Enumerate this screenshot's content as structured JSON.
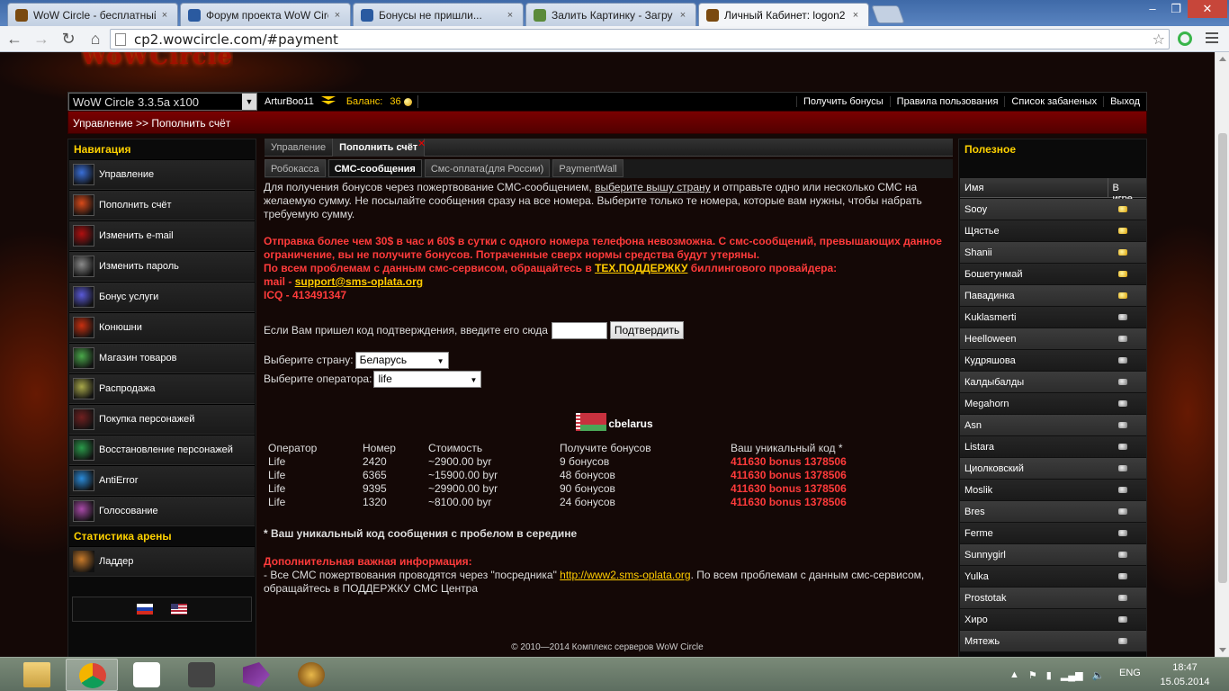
{
  "browser": {
    "tabs": [
      {
        "label": "WoW Circle - бесплатный",
        "icon": "wow-favicon"
      },
      {
        "label": "Форум проекта WoW Circ",
        "icon": "forum-favicon"
      },
      {
        "label": "Бонусы не пришли...",
        "icon": "forum-favicon"
      },
      {
        "label": "Залить Картинку - Загру",
        "icon": "image-host-favicon"
      },
      {
        "label": "Личный Кабинет: logon2",
        "icon": "wow-favicon",
        "active": true
      }
    ],
    "url": "cp2.wowcircle.com/#payment"
  },
  "site": {
    "logo_text": "WoWCircle",
    "realm": "WoW Circle 3.3.5a x100",
    "username": "ArturBoo11",
    "balance_label": "Баланс:",
    "balance_value": "36",
    "top_links": [
      "Получить бонусы",
      "Правила пользования",
      "Список забаненых",
      "Выход"
    ],
    "breadcrumb": "Управление >> Пополнить счёт"
  },
  "nav": {
    "heading": "Навигация",
    "items": [
      {
        "label": "Управление",
        "color": "#3a6fd8"
      },
      {
        "label": "Пополнить счёт",
        "color": "#d84a1a"
      },
      {
        "label": "Изменить e-mail",
        "color": "#b01010"
      },
      {
        "label": "Изменить пароль",
        "color": "#8a8a8a"
      },
      {
        "label": "Бонус услуги",
        "color": "#5a5ad8"
      },
      {
        "label": "Конюшни",
        "color": "#c83010"
      },
      {
        "label": "Магазин товаров",
        "color": "#4aa84a"
      },
      {
        "label": "Распродажа",
        "color": "#a8a84a"
      },
      {
        "label": "Покупка персонажей",
        "color": "#702020"
      },
      {
        "label": "Восстановление персонажей",
        "color": "#2a9a4a"
      },
      {
        "label": "AntiError",
        "color": "#2a8ad8"
      },
      {
        "label": "Голосование",
        "color": "#a84aa8"
      }
    ],
    "arena_heading": "Статистика арены",
    "arena_items": [
      {
        "label": "Ладдер",
        "color": "#c87a2a"
      }
    ]
  },
  "main": {
    "tabs": [
      {
        "label": "Управление"
      },
      {
        "label": "Пополнить счёт",
        "active": true,
        "closable": true
      }
    ],
    "subtabs": [
      {
        "label": "Робокасса"
      },
      {
        "label": "СМС-сообщения",
        "active": true
      },
      {
        "label": "Смс-оплата(для России)"
      },
      {
        "label": "PaymentWall"
      }
    ],
    "intro_1": "Для получения бонусов через пожертвование СМС-сообщением, ",
    "intro_link": "выберите вышу страну",
    "intro_2": " и отправьте одно или несколько СМС на желаемую сумму. Не посылайте сообщения сразу на все номера. Выберите только те номера, которые вам нужны, чтобы набрать требуемую сумму.",
    "warn_1": "Отправка более чем 30$ в час и 60$ в сутки с одного номера телефона невозможна. С смс-сообщений, превышающих данное ограничение, вы не получите бонусов. Потраченные сверх нормы средства будут утеряны.",
    "warn_2a": "По всем проблемам с данным смс-сервисом, обращайтесь в ",
    "warn_2link": "ТЕХ.ПОДДЕРЖКУ",
    "warn_2b": " биллингового провайдера:",
    "mail_label": "mail - ",
    "mail_link": "support@sms-oplata.org",
    "icq": "ICQ - 413491347",
    "confirm_label": "Если Вам пришел код подтверждения, введите его сюда",
    "confirm_button": "Подтвердить",
    "country_label": "Выберите страну:",
    "country_value": "Беларусь",
    "operator_label": "Выберите оператора:",
    "operator_value": "life",
    "country_title": "cbelarus",
    "table": {
      "headers": [
        "Оператор",
        "Номер",
        "Стоимость",
        "Получите бонусов",
        "Ваш уникальный код *"
      ],
      "rows": [
        [
          "Life",
          "2420",
          "~2900.00 byr",
          "9 бонусов",
          "411630 bonus 1378506"
        ],
        [
          "Life",
          "6365",
          "~15900.00 byr",
          "48 бонусов",
          "411630 bonus 1378506"
        ],
        [
          "Life",
          "9395",
          "~29900.00 byr",
          "90 бонусов",
          "411630 bonus 1378506"
        ],
        [
          "Life",
          "1320",
          "~8100.00 byr",
          "24 бонусов",
          "411630 bonus 1378506"
        ]
      ]
    },
    "note": "* Ваш уникальный код сообщения с пробелом в середине",
    "extra_heading": "Дополнительная важная информация:",
    "extra_1": "- Все СМС пожертвования проводятся через \"посредника\" ",
    "extra_link": "http://www2.sms-oplata.org",
    "extra_2": ". По всем проблемам с данным смс-сервисом, обращайтесь в ПОДДЕРЖКУ СМС Центра"
  },
  "right": {
    "heading": "Полезное",
    "col_name": "Имя",
    "col_status": "В игре",
    "players": [
      {
        "name": "Sooy",
        "online": true
      },
      {
        "name": "Щястье",
        "online": true
      },
      {
        "name": "Shanii",
        "online": true
      },
      {
        "name": "Бошетунмай",
        "online": true
      },
      {
        "name": "Павадинка",
        "online": true
      },
      {
        "name": "Kuklasmerti",
        "online": false
      },
      {
        "name": "Heelloween",
        "online": false
      },
      {
        "name": "Кудряшова",
        "online": false
      },
      {
        "name": "Калдыбалды",
        "online": false
      },
      {
        "name": "Megahorn",
        "online": false
      },
      {
        "name": "Asn",
        "online": false
      },
      {
        "name": "Listara",
        "online": false
      },
      {
        "name": "Циолковский",
        "online": false
      },
      {
        "name": "Moslik",
        "online": false
      },
      {
        "name": "Bres",
        "online": false
      },
      {
        "name": "Ferme",
        "online": false
      },
      {
        "name": "Sunnygirl",
        "online": false
      },
      {
        "name": "Yulka",
        "online": false
      },
      {
        "name": "Prostotak",
        "online": false
      },
      {
        "name": "Хиро",
        "online": false
      },
      {
        "name": "Мятежь",
        "online": false
      }
    ]
  },
  "footer": "© 2010—2014 Комплекс серверов WoW Circle",
  "taskbar": {
    "apps": [
      "explorer-icon",
      "chrome-icon",
      "app-icon",
      "tanks-icon",
      "visual-studio-icon",
      "wow-icon"
    ],
    "lang": "ENG",
    "time": "18:47",
    "date": "15.05.2014"
  }
}
